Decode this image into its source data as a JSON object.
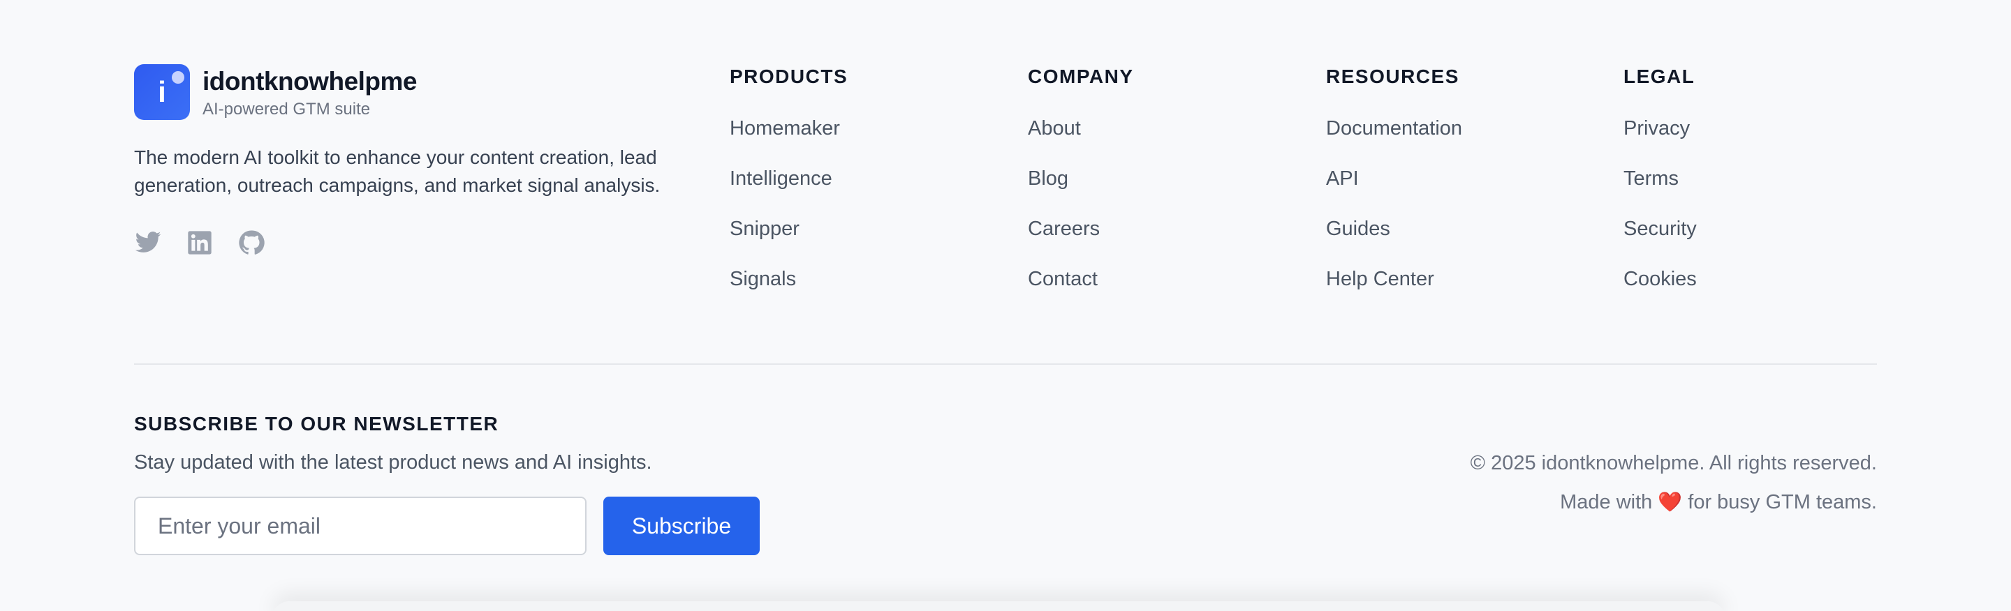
{
  "brand": {
    "logo_letter": "i",
    "name": "idontknowhelpme",
    "tagline": "AI-powered GTM suite",
    "description": "The modern AI toolkit to enhance your content creation, lead generation, outreach campaigns, and market signal analysis.",
    "socials": [
      "twitter-icon",
      "linkedin-icon",
      "github-icon"
    ],
    "accent_color": "#2f5bf0"
  },
  "columns": [
    {
      "title": "PRODUCTS",
      "links": [
        "Homemaker",
        "Intelligence",
        "Snipper",
        "Signals"
      ]
    },
    {
      "title": "COMPANY",
      "links": [
        "About",
        "Blog",
        "Careers",
        "Contact"
      ]
    },
    {
      "title": "RESOURCES",
      "links": [
        "Documentation",
        "API",
        "Guides",
        "Help Center"
      ]
    },
    {
      "title": "LEGAL",
      "links": [
        "Privacy",
        "Terms",
        "Security",
        "Cookies"
      ]
    }
  ],
  "newsletter": {
    "title": "SUBSCRIBE TO OUR NEWSLETTER",
    "subtitle": "Stay updated with the latest product news and AI insights.",
    "input_placeholder": "Enter your email",
    "button_label": "Subscribe",
    "button_color": "#2563eb"
  },
  "copyright": {
    "text": "© 2025 idontknowhelpme. All rights reserved.",
    "made_with_prefix": "Made with",
    "heart": "❤️",
    "made_with_suffix": "for busy GTM teams."
  }
}
